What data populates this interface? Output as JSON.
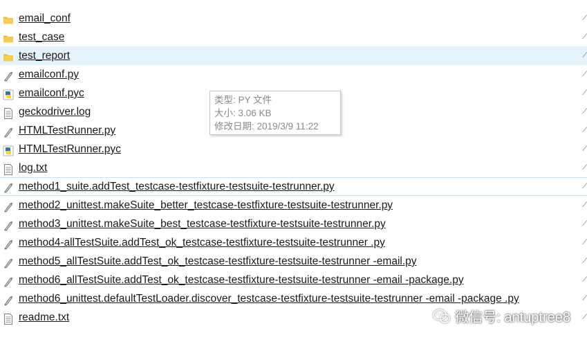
{
  "files": [
    {
      "name": "email_conf",
      "icon": "folder-icon"
    },
    {
      "name": "test_case",
      "icon": "folder-icon"
    },
    {
      "name": "test_report",
      "icon": "folder-icon",
      "selected": true
    },
    {
      "name": "emailconf.py",
      "icon": "python-file-icon"
    },
    {
      "name": "emailconf.pyc",
      "icon": "python-compiled-icon"
    },
    {
      "name": "geckodriver.log",
      "icon": "text-file-icon"
    },
    {
      "name": "HTMLTestRunner.py",
      "icon": "python-file-icon"
    },
    {
      "name": "HTMLTestRunner.pyc",
      "icon": "python-compiled-icon"
    },
    {
      "name": "log.txt",
      "icon": "text-file-icon"
    },
    {
      "name": "method1_suite.addTest_testcase-testfixture-testsuite-testrunner.py",
      "icon": "python-file-icon",
      "focused": true
    },
    {
      "name": "method2_unittest.makeSuite_better_testcase-testfixture-testsuite-testrunner.py",
      "icon": "python-file-icon"
    },
    {
      "name": "method3_unittest.makeSuite_best_testcase-testfixture-testsuite-testrunner.py",
      "icon": "python-file-icon"
    },
    {
      "name": "method4-allTestSuite.addTest_ok_testcase-testfixture-testsuite-testrunner .py",
      "icon": "python-file-icon"
    },
    {
      "name": "method5_allTestSuite.addTest_ok_testcase-testfixture-testsuite-testrunner -email.py",
      "icon": "python-file-icon"
    },
    {
      "name": "method6_allTestSuite.addTest_ok_testcase-testfixture-testsuite-testrunner -email -package.py",
      "icon": "python-file-icon"
    },
    {
      "name": "method6_unittest.defaultTestLoader.discover_testcase-testfixture-testsuite-testrunner -email -package .py",
      "icon": "python-file-icon"
    },
    {
      "name": "readme.txt",
      "icon": "text-file-icon"
    }
  ],
  "tooltip": {
    "type_line": "类型: PY 文件",
    "size_line": "大小: 3.06 KB",
    "modified_line": "修改日期: 2019/3/9 11:22"
  },
  "watermark": {
    "text": "微信号: antuptree8",
    "icon": "wechat-logo-icon"
  },
  "colors": {
    "selected_row": "#e5f3fb",
    "folder": "#f3c443",
    "python_blue": "#3772a4",
    "python_yellow": "#ffd43b"
  }
}
